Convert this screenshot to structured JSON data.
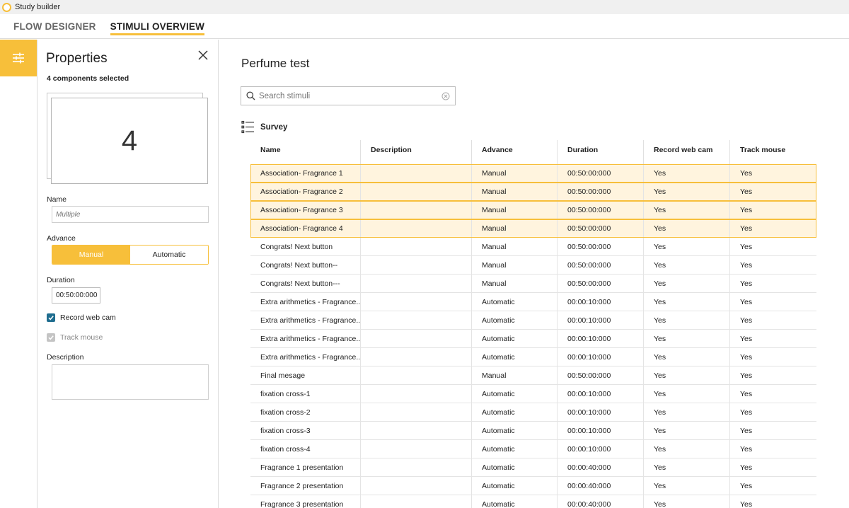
{
  "app": {
    "title": "Study builder"
  },
  "nav": {
    "tabs": [
      "FLOW DESIGNER",
      "STIMULI OVERVIEW"
    ]
  },
  "props": {
    "title": "Properties",
    "selected": "4 components selected",
    "count": "4",
    "name_label": "Name",
    "name_placeholder": "Multiple",
    "advance_label": "Advance",
    "advance_options": [
      "Manual",
      "Automatic"
    ],
    "advance_selected": "Manual",
    "duration_label": "Duration",
    "duration_value": "00:50:00:000",
    "record_label": "Record web cam",
    "track_label": "Track mouse",
    "description_label": "Description"
  },
  "main": {
    "title": "Perfume test",
    "search_placeholder": "Search stimuli",
    "section": "Survey",
    "columns": [
      "Name",
      "Description",
      "Advance",
      "Duration",
      "Record web cam",
      "Track mouse"
    ],
    "rows": [
      [
        "Association- Fragrance 1",
        "",
        "Manual",
        "00:50:00:000",
        "Yes",
        "Yes"
      ],
      [
        "Association- Fragrance 2",
        "",
        "Manual",
        "00:50:00:000",
        "Yes",
        "Yes"
      ],
      [
        "Association- Fragrance 3",
        "",
        "Manual",
        "00:50:00:000",
        "Yes",
        "Yes"
      ],
      [
        "Association- Fragrance 4",
        "",
        "Manual",
        "00:50:00:000",
        "Yes",
        "Yes"
      ],
      [
        "Congrats! Next button",
        "",
        "Manual",
        "00:50:00:000",
        "Yes",
        "Yes"
      ],
      [
        "Congrats! Next button--",
        "",
        "Manual",
        "00:50:00:000",
        "Yes",
        "Yes"
      ],
      [
        "Congrats! Next button---",
        "",
        "Manual",
        "00:50:00:000",
        "Yes",
        "Yes"
      ],
      [
        "Extra arithmetics - Fragrance...",
        "",
        "Automatic",
        "00:00:10:000",
        "Yes",
        "Yes"
      ],
      [
        "Extra arithmetics - Fragrance...",
        "",
        "Automatic",
        "00:00:10:000",
        "Yes",
        "Yes"
      ],
      [
        "Extra arithmetics - Fragrance...",
        "",
        "Automatic",
        "00:00:10:000",
        "Yes",
        "Yes"
      ],
      [
        "Extra arithmetics - Fragrance...",
        "",
        "Automatic",
        "00:00:10:000",
        "Yes",
        "Yes"
      ],
      [
        "Final mesage",
        "",
        "Manual",
        "00:50:00:000",
        "Yes",
        "Yes"
      ],
      [
        "fixation cross-1",
        "",
        "Automatic",
        "00:00:10:000",
        "Yes",
        "Yes"
      ],
      [
        "fixation cross-2",
        "",
        "Automatic",
        "00:00:10:000",
        "Yes",
        "Yes"
      ],
      [
        "fixation cross-3",
        "",
        "Automatic",
        "00:00:10:000",
        "Yes",
        "Yes"
      ],
      [
        "fixation cross-4",
        "",
        "Automatic",
        "00:00:10:000",
        "Yes",
        "Yes"
      ],
      [
        "Fragrance 1 presentation",
        "",
        "Automatic",
        "00:00:40:000",
        "Yes",
        "Yes"
      ],
      [
        "Fragrance 2 presentation",
        "",
        "Automatic",
        "00:00:40:000",
        "Yes",
        "Yes"
      ],
      [
        "Fragrance 3 presentation",
        "",
        "Automatic",
        "00:00:40:000",
        "Yes",
        "Yes"
      ]
    ],
    "selected_rows": [
      0,
      1,
      2,
      3
    ]
  },
  "colors": {
    "accent": "#f7bf3a",
    "selected_row_bg": "#fff4de",
    "checkbox": "#1f6d8f"
  }
}
